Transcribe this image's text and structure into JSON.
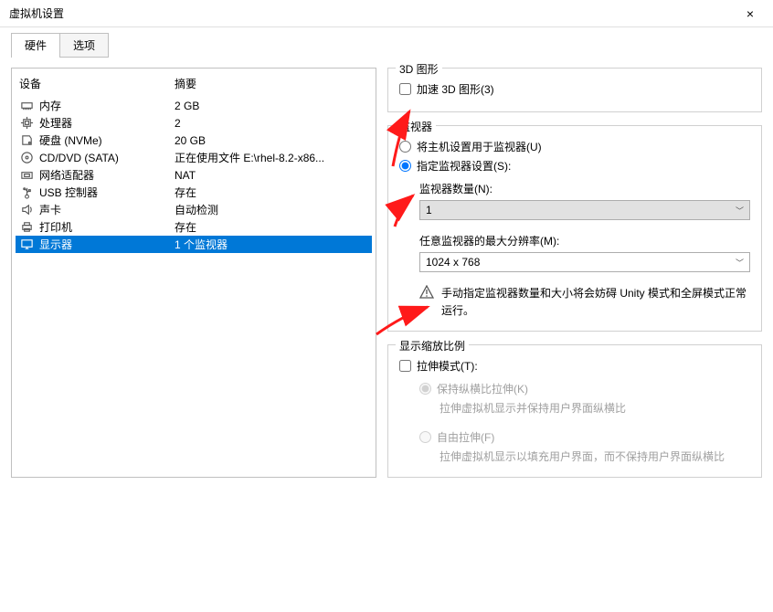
{
  "window": {
    "title": "虚拟机设置",
    "close_icon": "×"
  },
  "tabs": {
    "hardware": "硬件",
    "options": "选项"
  },
  "table": {
    "header_device": "设备",
    "header_summary": "摘要",
    "rows": [
      {
        "name": "内存",
        "summary": "2 GB",
        "icon": "memory"
      },
      {
        "name": "处理器",
        "summary": "2",
        "icon": "cpu"
      },
      {
        "name": "硬盘 (NVMe)",
        "summary": "20 GB",
        "icon": "disk"
      },
      {
        "name": "CD/DVD (SATA)",
        "summary": "正在使用文件 E:\\rhel-8.2-x86...",
        "icon": "cd"
      },
      {
        "name": "网络适配器",
        "summary": "NAT",
        "icon": "net"
      },
      {
        "name": "USB 控制器",
        "summary": "存在",
        "icon": "usb"
      },
      {
        "name": "声卡",
        "summary": "自动检测",
        "icon": "sound"
      },
      {
        "name": "打印机",
        "summary": "存在",
        "icon": "printer"
      },
      {
        "name": "显示器",
        "summary": "1 个监视器",
        "icon": "display"
      }
    ]
  },
  "graphics3d": {
    "title": "3D 图形",
    "accel_label": "加速 3D 图形(3)"
  },
  "monitors": {
    "title": "监视器",
    "use_host": "将主机设置用于监视器(U)",
    "specify": "指定监视器设置(S):",
    "count_label": "监视器数量(N):",
    "count_value": "1",
    "maxres_label": "任意监视器的最大分辨率(M):",
    "maxres_value": "1024 x 768",
    "warn": "手动指定监视器数量和大小将会妨碍 Unity 模式和全屏模式正常运行。"
  },
  "scale": {
    "title": "显示缩放比例",
    "stretch_label": "拉伸模式(T):",
    "keep_ratio": "保持纵横比拉伸(K)",
    "keep_ratio_desc": "拉伸虚拟机显示并保持用户界面纵横比",
    "free": "自由拉伸(F)",
    "free_desc": "拉伸虚拟机显示以填充用户界面，而不保持用户界面纵横比"
  }
}
